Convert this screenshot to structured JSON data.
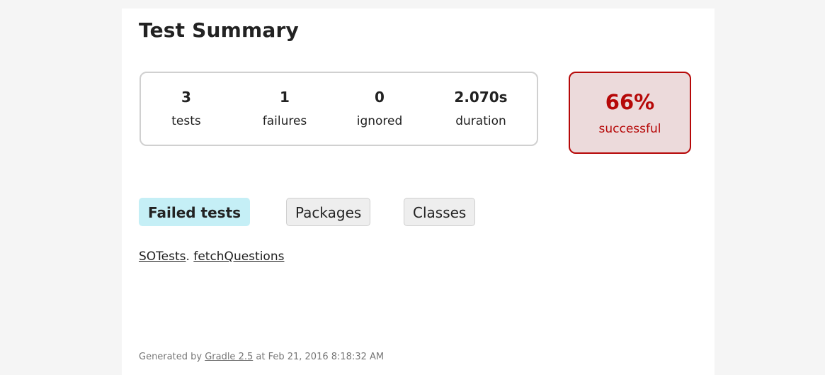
{
  "summary": {
    "title": "Test Summary",
    "counters": [
      {
        "value": "3",
        "label": "tests"
      },
      {
        "value": "1",
        "label": "failures"
      },
      {
        "value": "0",
        "label": "ignored"
      },
      {
        "value": "2.070s",
        "label": "duration"
      }
    ],
    "success_rate": "66%",
    "success_label": "successful",
    "success_color": "#b60808",
    "success_bg": "#ecdadb"
  },
  "tabs": [
    {
      "label": "Failed tests",
      "selected": true
    },
    {
      "label": "Packages",
      "selected": false
    },
    {
      "label": "Classes",
      "selected": false
    }
  ],
  "failed_tests": {
    "class": "SOTests",
    "separator": ".",
    "method": "fetchQuestions"
  },
  "footer": {
    "prefix": "Generated by ",
    "link": "Gradle 2.5",
    "suffix": " at Feb 21, 2016 8:18:32 AM"
  }
}
